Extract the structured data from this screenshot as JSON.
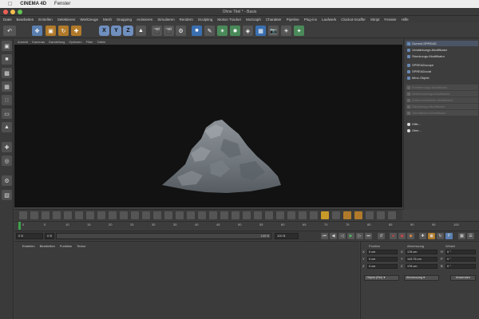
{
  "mac": {
    "app_name": "CINEMA 4D",
    "menu": "Fenster"
  },
  "window": {
    "title": "Ohne Titel * - Basis"
  },
  "menubar": [
    "Datei",
    "Bearbeiten",
    "Erstellen",
    "Selektieren",
    "Werkzeuge",
    "Mesh",
    "Snapping",
    "Animieren",
    "Simulieren",
    "Rendern",
    "Sculpting",
    "Motion Tracker",
    "MoGraph",
    "Charakter",
    "Pipeline",
    "Plug-ins",
    "Laufwerk",
    "Clockot-Scaffer",
    "Skript",
    "Fenster",
    "Hilfe"
  ],
  "toolbar": {
    "axes": [
      "X",
      "Y",
      "Z"
    ]
  },
  "viewport": {
    "menu": [
      "Ansicht",
      "Kameras",
      "Darstellung",
      "Optionen",
      "Filter",
      "Tafeln"
    ]
  },
  "objects": [
    {
      "label": "Gummi-SPREAD",
      "state": "hl"
    },
    {
      "label": "Verstärkungs-Modifikator",
      "state": "normal"
    },
    {
      "label": "Streckungs-Modifikator",
      "state": "normal"
    },
    {
      "label": "SPREADscope",
      "state": "normal"
    },
    {
      "label": "SPREADcoat",
      "state": "normal"
    },
    {
      "label": "Mine-Objekt",
      "state": "normal"
    },
    {
      "label": "Erweiterungs-Modifikator",
      "state": "ghost"
    },
    {
      "label": "Verkrümmungs-Modifikator",
      "state": "ghost"
    },
    {
      "label": "Zerbrechlichkeits-Modifikator",
      "state": "ghost"
    },
    {
      "label": "Dämpfungs-Modifikator",
      "state": "ghost"
    },
    {
      "label": "Oberflächen-Modifikator",
      "state": "ghost"
    },
    {
      "label": "Hille...",
      "state": "normal"
    },
    {
      "label": "Über...",
      "state": "normal"
    }
  ],
  "timeline": {
    "ticks": [
      "0",
      "5",
      "10",
      "15",
      "20",
      "25",
      "30",
      "35",
      "40",
      "45",
      "50",
      "55",
      "60",
      "65",
      "70",
      "75",
      "80",
      "85",
      "90",
      "95",
      "100"
    ],
    "current_frame": 0
  },
  "transport": {
    "start": "0 B",
    "field2": "0 B",
    "end_left": "100 B",
    "end_right": "100 B"
  },
  "material_menu": [
    "Erstellen",
    "Bearbeiten",
    "Funktion",
    "Textur"
  ],
  "coords": {
    "headers": [
      "Position",
      "Abmessung",
      "Winkel"
    ],
    "rows": [
      {
        "axis": "X",
        "pos": "0 cm",
        "dim_axis": "X",
        "dim": "176 cm",
        "ang_axis": "H",
        "ang": "0 °"
      },
      {
        "axis": "Y",
        "pos": "0 cm",
        "dim_axis": "Y",
        "dim": "143.76 cm",
        "ang_axis": "P",
        "ang": "0 °"
      },
      {
        "axis": "Z",
        "pos": "0 cm",
        "dim_axis": "Z",
        "dim": "176 cm",
        "ang_axis": "B",
        "ang": "0 °"
      }
    ],
    "mode": "Objekt (Rel)",
    "scale_mode": "Abmessung",
    "apply": "Anwenden"
  },
  "colors": {
    "accent": "#5a7fb0",
    "playhead": "#3fa04c",
    "mountain": "#7a8085"
  }
}
